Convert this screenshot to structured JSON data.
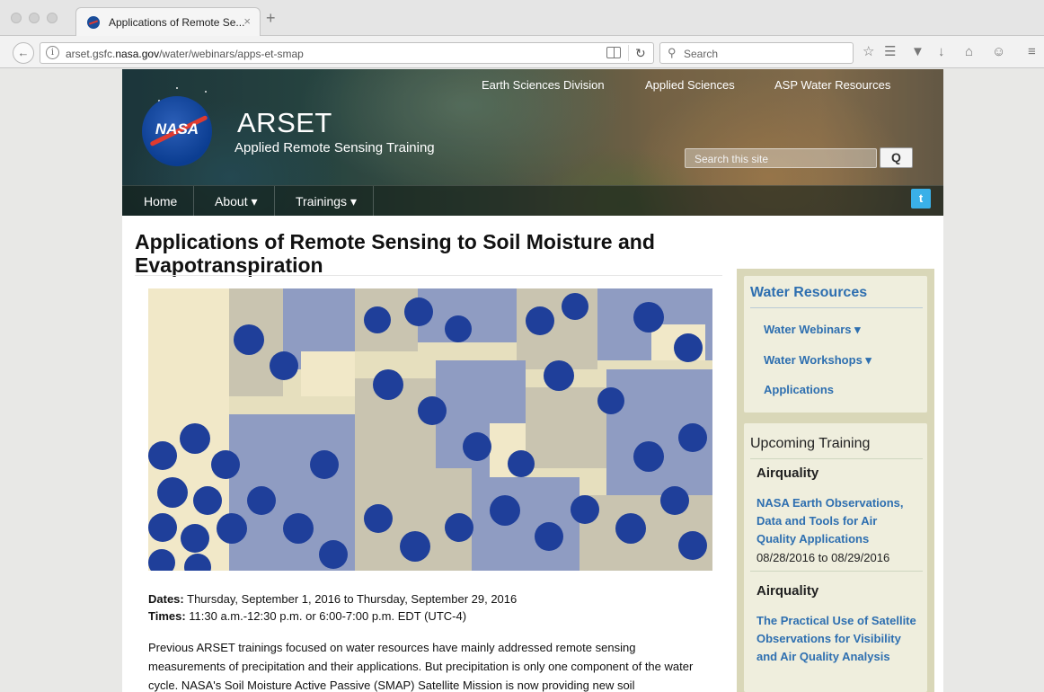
{
  "browser": {
    "tab_title": "Applications of Remote Se...",
    "tab_close": "×",
    "new_tab": "+",
    "url_prefix": "arset.gsfc.",
    "url_domain": "nasa.gov",
    "url_path": "/water/webinars/apps-et-smap",
    "search_placeholder": "Search"
  },
  "site": {
    "logo_text": "NASA",
    "title": "ARSET",
    "subtitle": "Applied Remote Sensing Training",
    "top_links": [
      "Earth Sciences Division",
      "Applied Sciences",
      "ASP Water Resources"
    ],
    "search_placeholder": "Search this site",
    "search_button": "Q",
    "nav": [
      "Home",
      "About ▾",
      "Trainings ▾"
    ],
    "twitter": "t"
  },
  "article": {
    "title": "Applications of Remote Sensing to Soil Moisture and Evapotranspiration",
    "dates_label": "Dates:",
    "dates_value": " Thursday, September 1, 2016 to Thursday, September 29, 2016",
    "times_label": "Times:",
    "times_value": " 11:30 a.m.-12:30 p.m. or 6:00-7:00 p.m. EDT (UTC-4)",
    "body": "Previous ARSET trainings focused on water resources have mainly addressed remote sensing measurements of precipitation and their applications. But precipitation is only one component of the water cycle. NASA's Soil Moisture Active Passive (SMAP) Satellite Mission is now providing new soil"
  },
  "sidebar": {
    "water_heading": "Water Resources",
    "water_links": [
      "Water Webinars ▾",
      "Water Workshops ▾",
      "Applications"
    ],
    "upcoming_heading": "Upcoming Training",
    "trainings": [
      {
        "category": "Airquality",
        "title": "NASA Earth Observations, Data and Tools for Air Quality Applications",
        "dates": "08/28/2016 to 08/29/2016"
      },
      {
        "category": "Airquality",
        "title": "The Practical Use of Satellite Observations for Visibility and Air Quality Analysis"
      }
    ]
  }
}
